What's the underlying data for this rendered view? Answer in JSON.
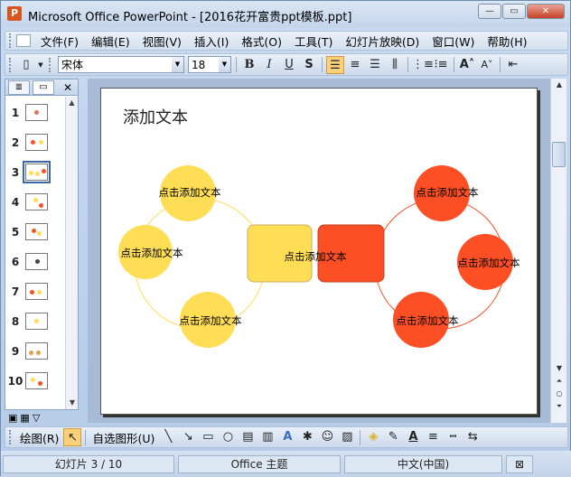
{
  "window": {
    "title": "Microsoft Office PowerPoint - [2016花开富贵ppt模板.ppt]",
    "minimize": "—",
    "restore": "▭",
    "close": "✕"
  },
  "menu": [
    "文件(F)",
    "编辑(E)",
    "视图(V)",
    "插入(I)",
    "格式(O)",
    "工具(T)",
    "幻灯片放映(D)",
    "窗口(W)",
    "帮助(H)"
  ],
  "toolbar": {
    "font": "宋体",
    "size": "18",
    "bold": "B",
    "italic": "I",
    "underline": "U",
    "shadow": "S"
  },
  "pane": {
    "slides": [
      "1",
      "2",
      "3",
      "4",
      "5",
      "6",
      "7",
      "8",
      "9",
      "10"
    ],
    "selected": 3
  },
  "slide": {
    "title": "添加文本",
    "left_labels": [
      "点击添加文本",
      "点击添加文本",
      "点击添加文本"
    ],
    "center_left": "点击添加文本",
    "right_labels": [
      "点击添加文本",
      "点击添加文本",
      "点击添加文本"
    ],
    "colors": {
      "yellow": "#ffdd55",
      "orange": "#fc4f25"
    }
  },
  "drawbar": {
    "draw": "绘图(R)",
    "autoshapes": "自选图形(U)"
  },
  "status": {
    "slide_num": "幻灯片 3 / 10",
    "theme": "Office 主题",
    "lang": "中文(中国)"
  }
}
